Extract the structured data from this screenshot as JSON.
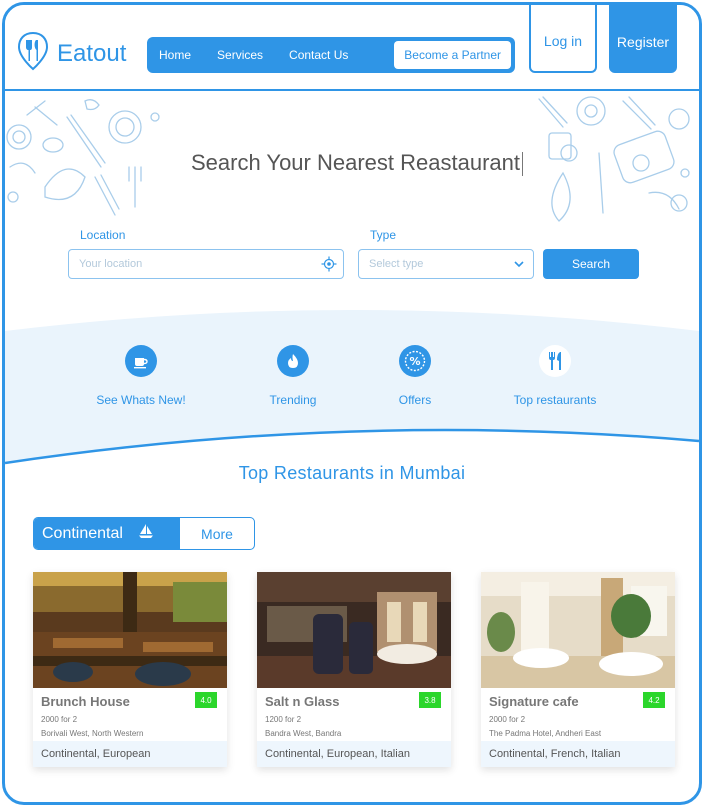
{
  "brand": {
    "name": "Eatout",
    "color": "#2f95e6"
  },
  "nav": {
    "links": [
      "Home",
      "Services",
      "Contact Us"
    ],
    "partner": "Become a Partner",
    "login": "Log in",
    "register": "Register"
  },
  "hero": {
    "title": "Search Your Nearest Reastaurant"
  },
  "search": {
    "location_label": "Location",
    "location_placeholder": "Your location",
    "type_label": "Type",
    "type_placeholder": "Select type",
    "button": "Search"
  },
  "categories": [
    {
      "label": "See Whats New!",
      "icon": "cup-icon"
    },
    {
      "label": "Trending",
      "icon": "flame-icon"
    },
    {
      "label": "Offers",
      "icon": "percent-icon"
    },
    {
      "label": "Top restaurants",
      "icon": "cutlery-icon"
    }
  ],
  "section_title": "Top Restaurants in Mumbai",
  "tabs": {
    "active": "Continental",
    "more": "More"
  },
  "restaurants": [
    {
      "name": "Brunch House",
      "rating": "4.0",
      "price": "2000 for 2",
      "address": "Borivali West, North Western",
      "cuisine": "Continental, European",
      "icon": "restaurant-photo"
    },
    {
      "name": "Salt n Glass",
      "rating": "3.8",
      "price": "1200 for 2",
      "address": "Bandra West, Bandra",
      "cuisine": "Continental, European, Italian",
      "icon": "restaurant-photo"
    },
    {
      "name": "Signature cafe",
      "rating": "4.2",
      "price": "2000 for 2",
      "address": "The Padma Hotel, Andheri East",
      "cuisine": "Continental, French, Italian",
      "icon": "restaurant-photo"
    }
  ],
  "colors": {
    "accent": "#2f95e6",
    "rating": "#2bd62b",
    "band": "#eaf4fc"
  }
}
